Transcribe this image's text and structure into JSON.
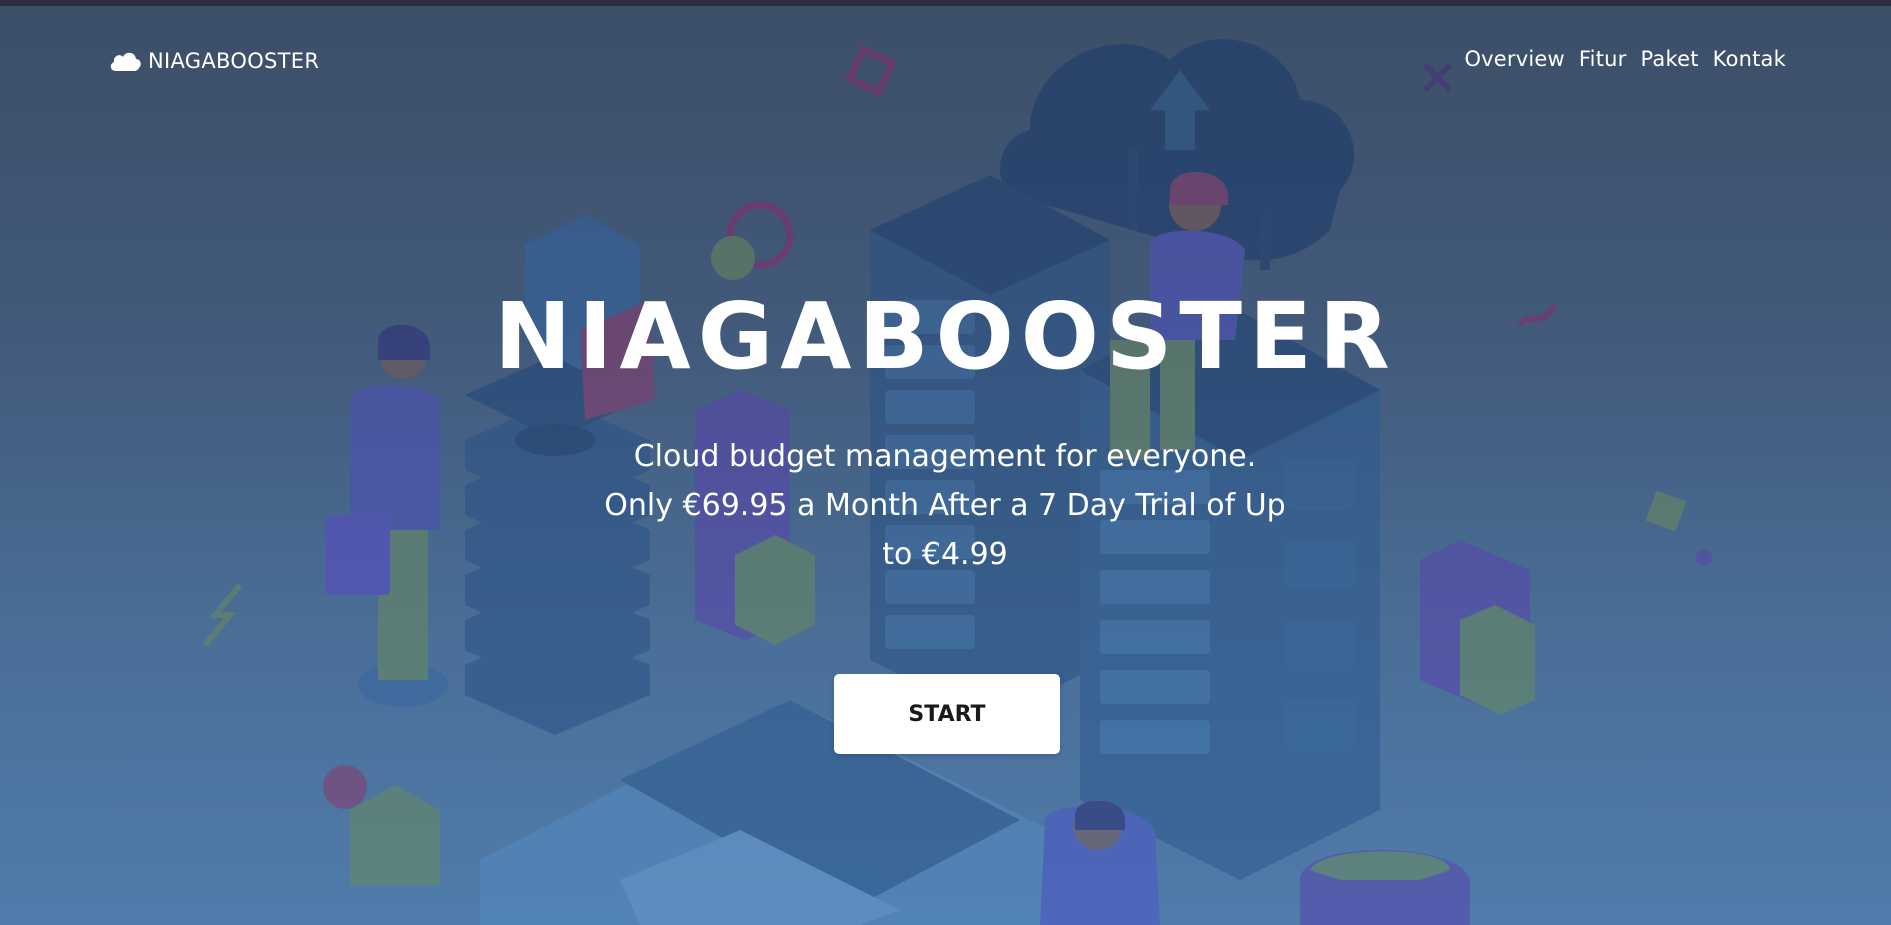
{
  "header": {
    "brand_label": "NIAGABOOSTER",
    "brand_icon": "cloud-icon",
    "nav": [
      {
        "label": "Overview"
      },
      {
        "label": "Fitur"
      },
      {
        "label": "Paket"
      },
      {
        "label": "Kontak"
      }
    ]
  },
  "hero": {
    "title": "NIAGABOOSTER",
    "subtitle": "Cloud budget management for everyone. Only €69.95 a Month After a 7 Day Trial of Up to €4.99",
    "cta_label": "START"
  },
  "colors": {
    "background_top": "#3c4f68",
    "background_bottom": "#4f7cab",
    "text": "#ffffff",
    "button_bg": "#ffffff",
    "button_text": "#1a1a1a"
  }
}
